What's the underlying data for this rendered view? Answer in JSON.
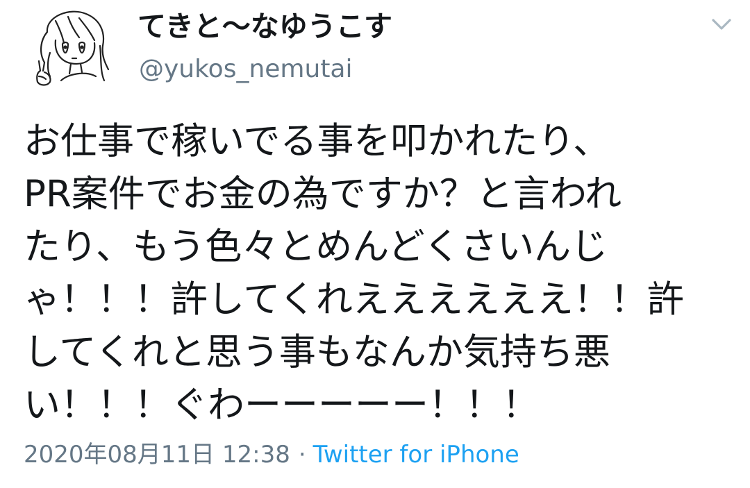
{
  "user": {
    "display_name": "てきと〜なゆうこす",
    "handle": "@yukos_nemutai",
    "avatar_icon": "avatar-drawing-icon"
  },
  "menu": {
    "caret_icon": "chevron-down-icon"
  },
  "tweet": {
    "lines": [
      "お仕事で稼いでる事を叩かれたり、",
      "PR案件でお金の為ですか？と言われ",
      "たり、もう色々とめんどくさいんじ",
      "ゃ！！！許してくれええええええ！！許",
      "してくれと思う事もなんか気持ち悪",
      "い！！！ぐわーーーーー！！！"
    ]
  },
  "meta": {
    "timestamp": "2020年08月11日 12:38",
    "separator": "·",
    "source": "Twitter for iPhone"
  },
  "colors": {
    "text": "#14171a",
    "secondary": "#657786",
    "link": "#1da1f2"
  }
}
